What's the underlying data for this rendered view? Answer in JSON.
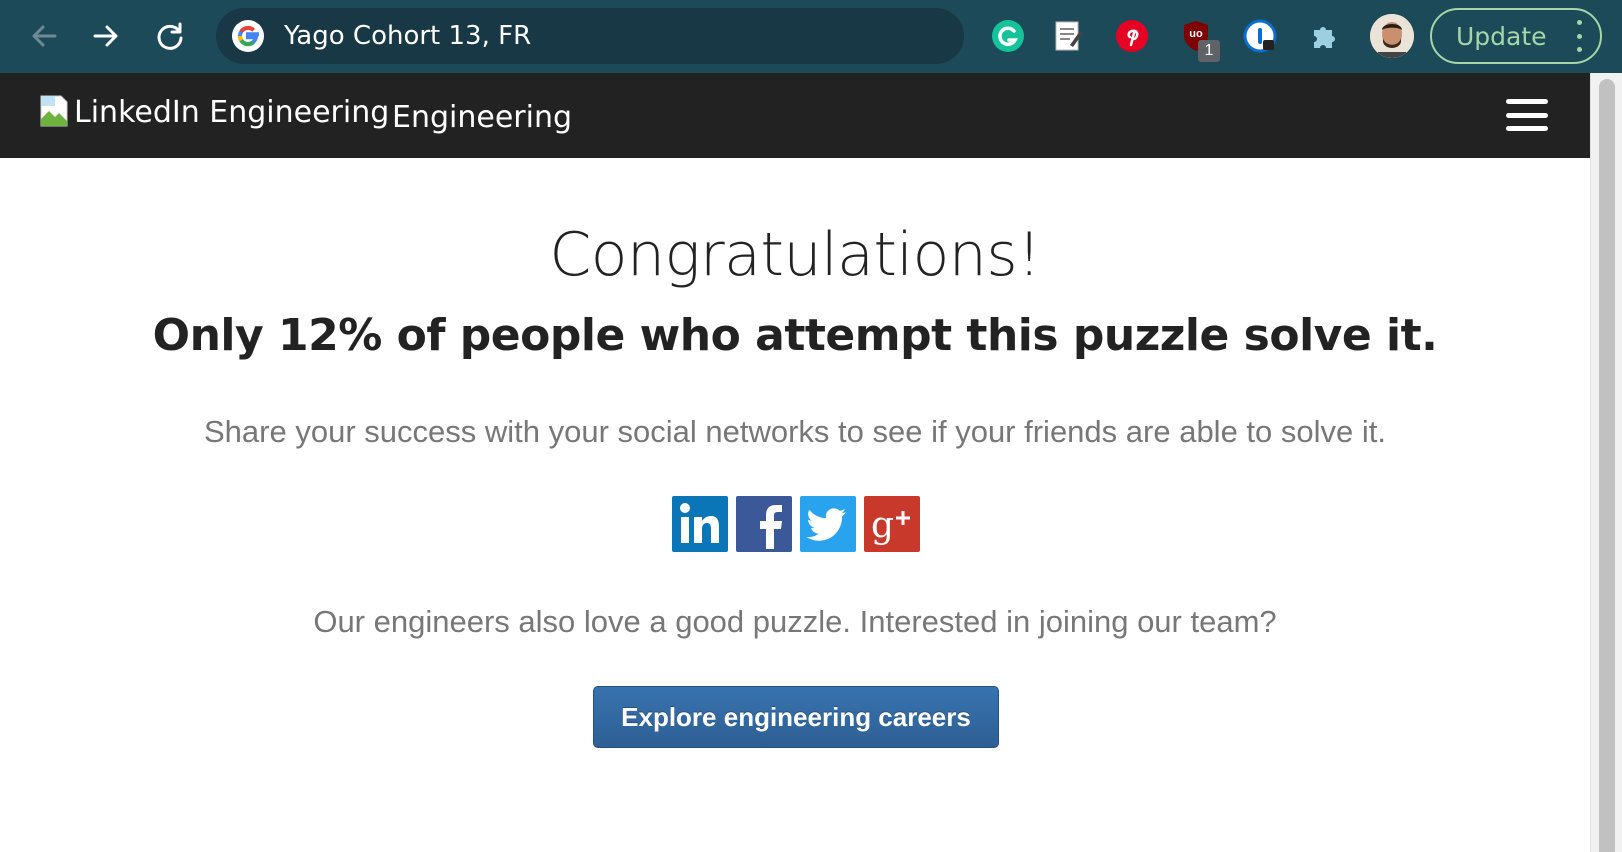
{
  "browser": {
    "omnibox_text": "Yago Cohort 13, FR",
    "update_label": "Update",
    "ublock_badge": "1",
    "nav_icons": [
      "back-arrow-icon",
      "forward-arrow-icon",
      "reload-icon"
    ],
    "extensions": [
      "grammarly-icon",
      "notes-extension-icon",
      "pinterest-icon",
      "ublock-origin-icon",
      "onepassword-icon",
      "puzzle-extensions-icon"
    ]
  },
  "header": {
    "logo_alt": "LinkedIn Engineering",
    "brand": "Engineering"
  },
  "main": {
    "headline": "Congratulations!",
    "subhead": "Only 12% of people who attempt this puzzle solve it.",
    "share_text": "Share your success with your social networks to see if your friends are able to solve it.",
    "social": [
      {
        "name": "linkedin",
        "label": "in",
        "color": "#0b76b7"
      },
      {
        "name": "facebook",
        "label": "f",
        "color": "#3b5998"
      },
      {
        "name": "twitter",
        "label": "twitter-bird",
        "color": "#2aa3ef"
      },
      {
        "name": "google-plus",
        "label": "g+",
        "color": "#c9392b"
      }
    ],
    "careers_text": "Our engineers also love a good puzzle. Interested in joining our team?",
    "cta_label": "Explore engineering careers"
  },
  "colors": {
    "toolbar_bg": "#1d4a59",
    "header_bg": "#222222",
    "cta_bg": "#3068a2",
    "muted_text": "#777777",
    "update_green": "#a5d6a7"
  }
}
